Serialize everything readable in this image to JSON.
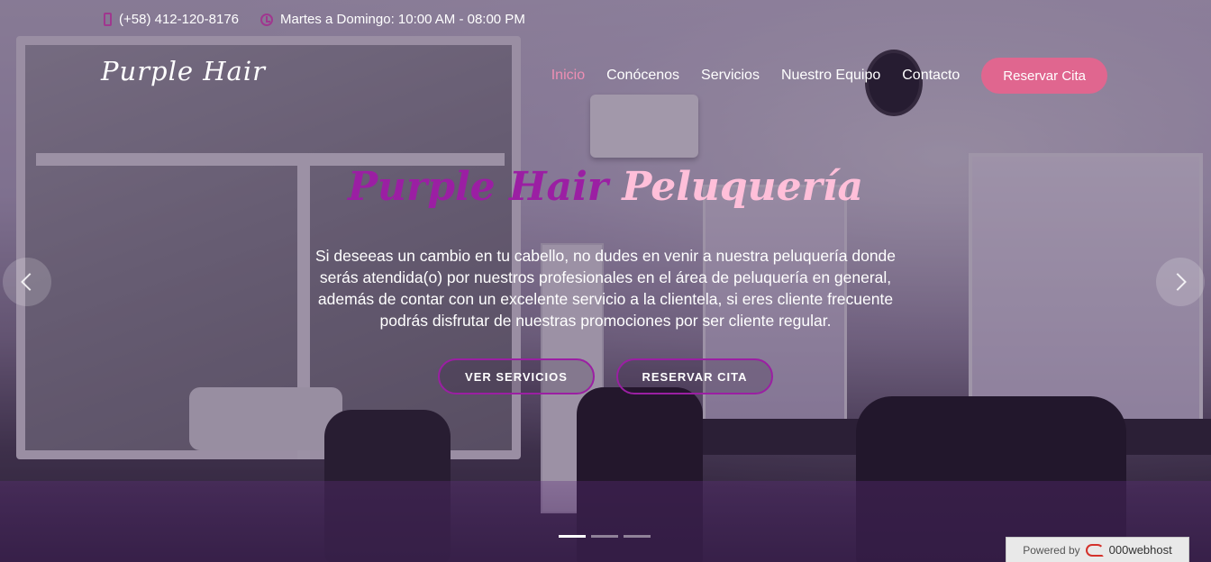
{
  "topbar": {
    "phone": "(+58) 412-120-8176",
    "hours": "Martes a Domingo: 10:00 AM - 08:00 PM",
    "phone_icon": "phone-icon",
    "clock_icon": "clock-icon"
  },
  "brand": "Purple Hair",
  "nav": {
    "items": [
      {
        "label": "Inicio",
        "active": true
      },
      {
        "label": "Conócenos",
        "active": false
      },
      {
        "label": "Servicios",
        "active": false
      },
      {
        "label": "Nuestro Equipo",
        "active": false
      },
      {
        "label": "Contacto",
        "active": false
      }
    ],
    "cta": "Reservar Cita"
  },
  "hero": {
    "title_part1": "Purple Hair",
    "title_part2": "Peluquería",
    "description": "Si deseeas un cambio en tu cabello, no dudes en venir a nuestra peluquería donde serás atendida(o) por nuestros profesionales en el área de peluquería en general, además de contar con un excelente servicio a la clientela, si eres cliente frecuente podrás disfrutar de nuestras promociones por ser cliente regular.",
    "btn_services": "VER SERVICIOS",
    "btn_book": "RESERVAR CITA"
  },
  "carousel": {
    "prev_icon": "chevron-left-icon",
    "next_icon": "chevron-right-icon",
    "slides": 3,
    "active_slide": 1
  },
  "powered": {
    "label": "Powered by",
    "brand": "000webhost"
  },
  "colors": {
    "accent_purple": "#9b1fa3",
    "accent_pink": "#e0668f",
    "title_pink": "#ffbfd9",
    "nav_active": "#ee8fb4"
  }
}
